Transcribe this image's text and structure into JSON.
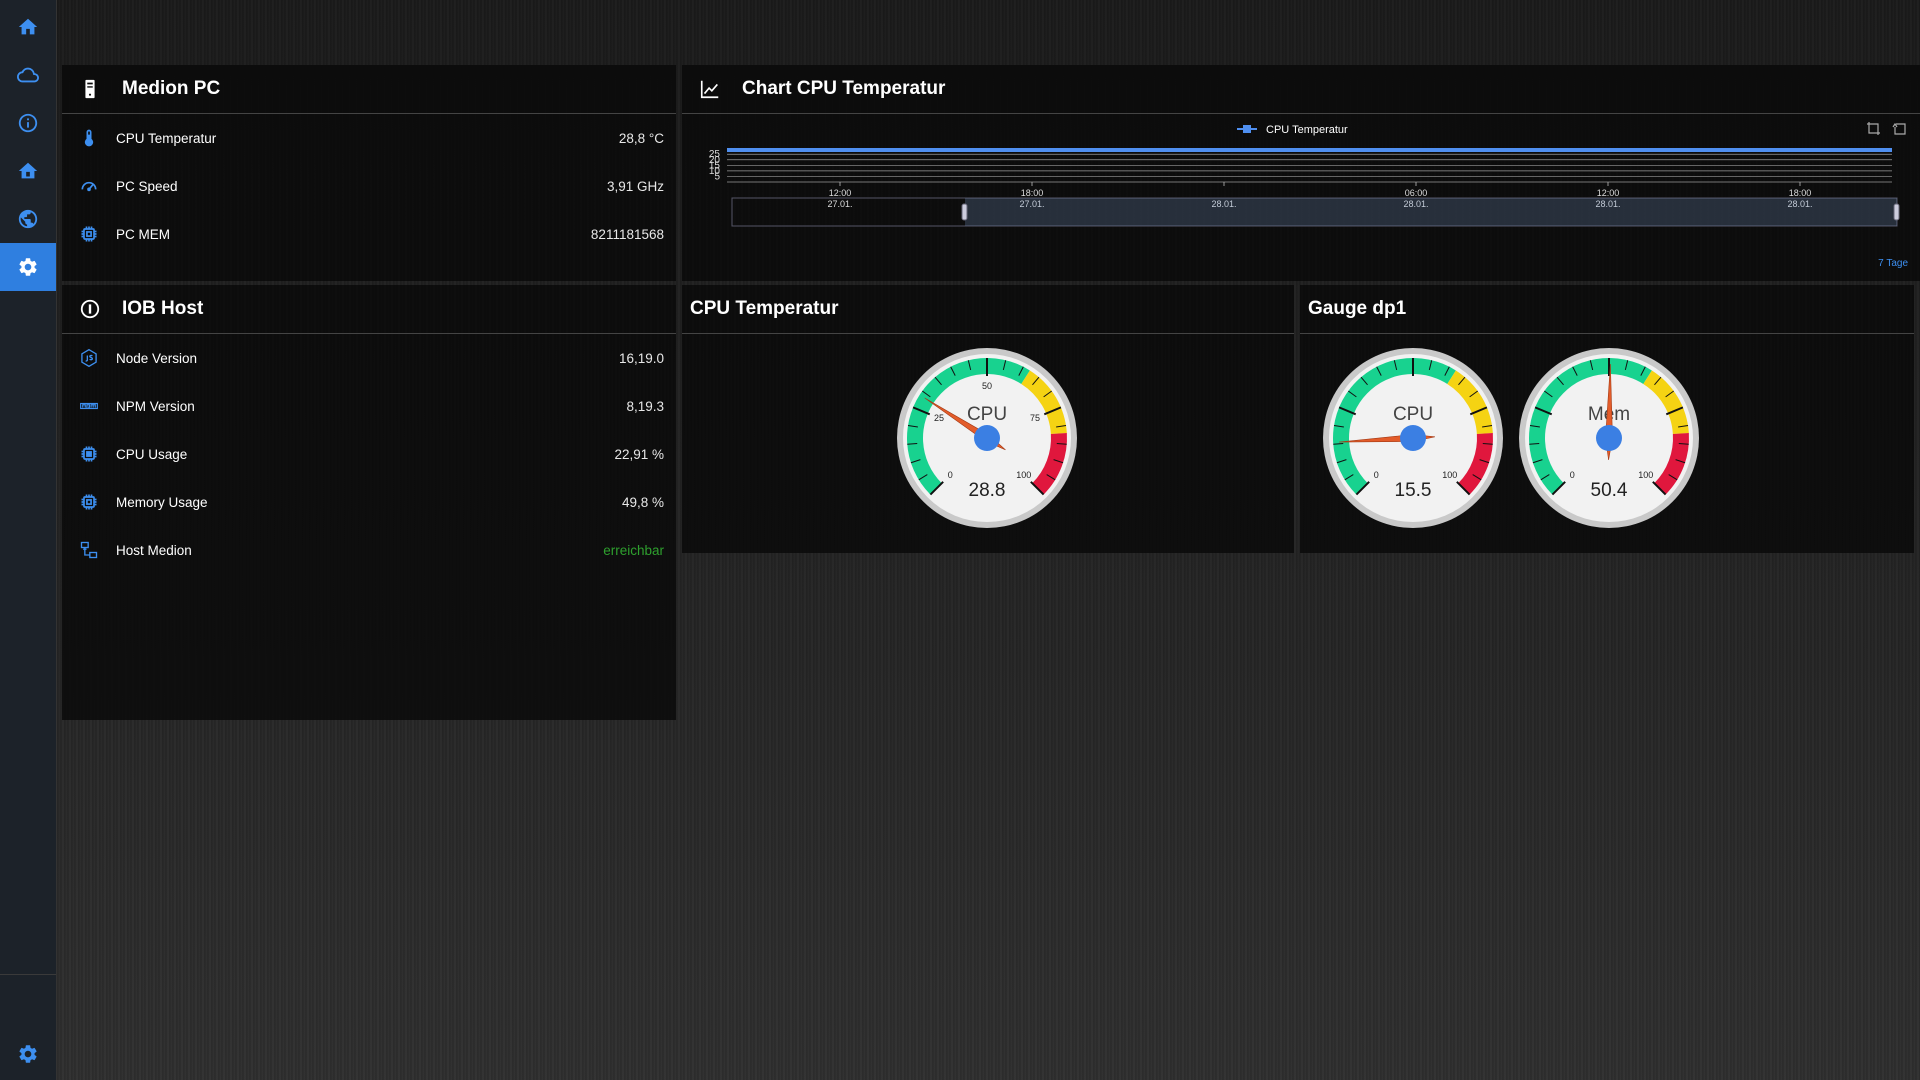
{
  "sidebar": {
    "items": [
      {
        "icon": "home-icon"
      },
      {
        "icon": "cloud-icon"
      },
      {
        "icon": "info-icon"
      },
      {
        "icon": "house-icon"
      },
      {
        "icon": "globe-icon"
      },
      {
        "icon": "gear-icon",
        "active": true
      }
    ],
    "bottom_icon": "gear-icon"
  },
  "medion_pc": {
    "title": "Medion PC",
    "rows": [
      {
        "label": "CPU Temperatur",
        "value": "28,8 °C",
        "icon": "thermometer-icon"
      },
      {
        "label": "PC Speed",
        "value": "3,91 GHz",
        "icon": "speedometer-icon"
      },
      {
        "label": "PC MEM",
        "value": "8211181568",
        "icon": "chip-icon"
      }
    ]
  },
  "iob_host": {
    "title": "IOB Host",
    "rows": [
      {
        "label": "Node Version",
        "value": "16,19.0",
        "icon": "nodejs-icon"
      },
      {
        "label": "NPM Version",
        "value": "8,19.3",
        "icon": "npm-icon"
      },
      {
        "label": "CPU Usage",
        "value": "22,91 %",
        "icon": "chip-icon"
      },
      {
        "label": "Memory Usage",
        "value": "49,8 %",
        "icon": "chip-icon"
      },
      {
        "label": "Host Medion",
        "value": "erreichbar",
        "icon": "network-icon"
      }
    ]
  },
  "chart_panel": {
    "title": "Chart CPU Temperatur",
    "range_label": "7 Tage"
  },
  "chart_data": {
    "type": "line",
    "series": [
      {
        "name": "CPU Temperatur",
        "color": "#4f8ff0",
        "values": [
          28.8,
          28.8,
          28.8,
          28.8,
          28.8,
          28.8,
          28.8
        ]
      }
    ],
    "y_ticks": [
      "25",
      "20",
      "15",
      "10",
      "5"
    ],
    "x_ticks": [
      {
        "time": "12:00",
        "date": "27.01."
      },
      {
        "time": "18:00",
        "date": "27.01."
      },
      {
        "time": "",
        "date": "28.01."
      },
      {
        "time": "06:00",
        "date": "28.01."
      },
      {
        "time": "12:00",
        "date": "28.01."
      },
      {
        "time": "18:00",
        "date": "28.01."
      }
    ],
    "ylim": [
      0,
      28.8
    ],
    "legend": "top-center"
  },
  "cpu_temp_panel": {
    "title": "CPU Temperatur",
    "gauge": {
      "label": "CPU",
      "value": 28.8,
      "display": "28.8",
      "min": 0,
      "max": 100,
      "ticks": [
        "0",
        "25",
        "50",
        "75",
        "100"
      ]
    }
  },
  "gauge_dp1_panel": {
    "title": "Gauge dp1",
    "gauges": [
      {
        "label": "CPU",
        "value": 15.5,
        "display": "15.5",
        "min": 0,
        "max": 100,
        "ticks": [
          "0",
          "100"
        ]
      },
      {
        "label": "Mem",
        "value": 50.4,
        "display": "50.4",
        "min": 0,
        "max": 100,
        "ticks": [
          "0",
          "100"
        ]
      }
    ]
  }
}
